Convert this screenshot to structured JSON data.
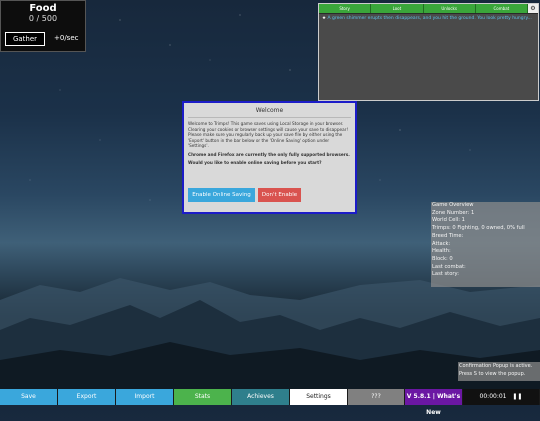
{
  "resource": {
    "title": "Food",
    "amount": "0 / 500",
    "gather_label": "Gather",
    "rate": "+0/sec"
  },
  "log": {
    "tabs": [
      "Story",
      "Loot",
      "Unlocks",
      "Combat"
    ],
    "gear_icon": "gear-icon",
    "message": "A green shimmer erupts then disappears, and you hit the ground. You look pretty hungry..."
  },
  "popup": {
    "title": "Welcome",
    "paragraph1": "Welcome to Trimps! This game saves using Local Storage in your browser. Clearing your cookies or browser settings will cause your save to disappear! Please make sure you regularly back up your save file by either using the 'Export' button in the bar below or the 'Online Saving' option under 'Settings'.",
    "paragraph2": "Chrome and Firefox are currently the only fully supported browsers.",
    "paragraph3": "Would you like to enable online saving before you start?",
    "enable_label": "Enable Online Saving",
    "dont_label": "Don't Enable"
  },
  "overview": {
    "title": "Game Overview",
    "zone": "Zone Number: 1",
    "cell": "World Cell: 1",
    "trimps": "Trimps: 0 Fighting, 0 owned, 0% full",
    "breed": "Breed Time:",
    "attack": "Attack:",
    "health": "Health:",
    "block": "Block: 0",
    "last_combat": "Last combat:",
    "last_story": "Last story:"
  },
  "confirm": {
    "line1": "Confirmation Popup is active.",
    "line2": "Press S to view the popup."
  },
  "bottom_bar": {
    "save": "Save",
    "export": "Export",
    "import": "Import",
    "stats": "Stats",
    "achieves": "Achieves",
    "settings": "Settings",
    "unknown": "???",
    "version": "V 5.8.1 | What's New",
    "timer": "00:00:01",
    "pause_icon": "pause-icon"
  }
}
